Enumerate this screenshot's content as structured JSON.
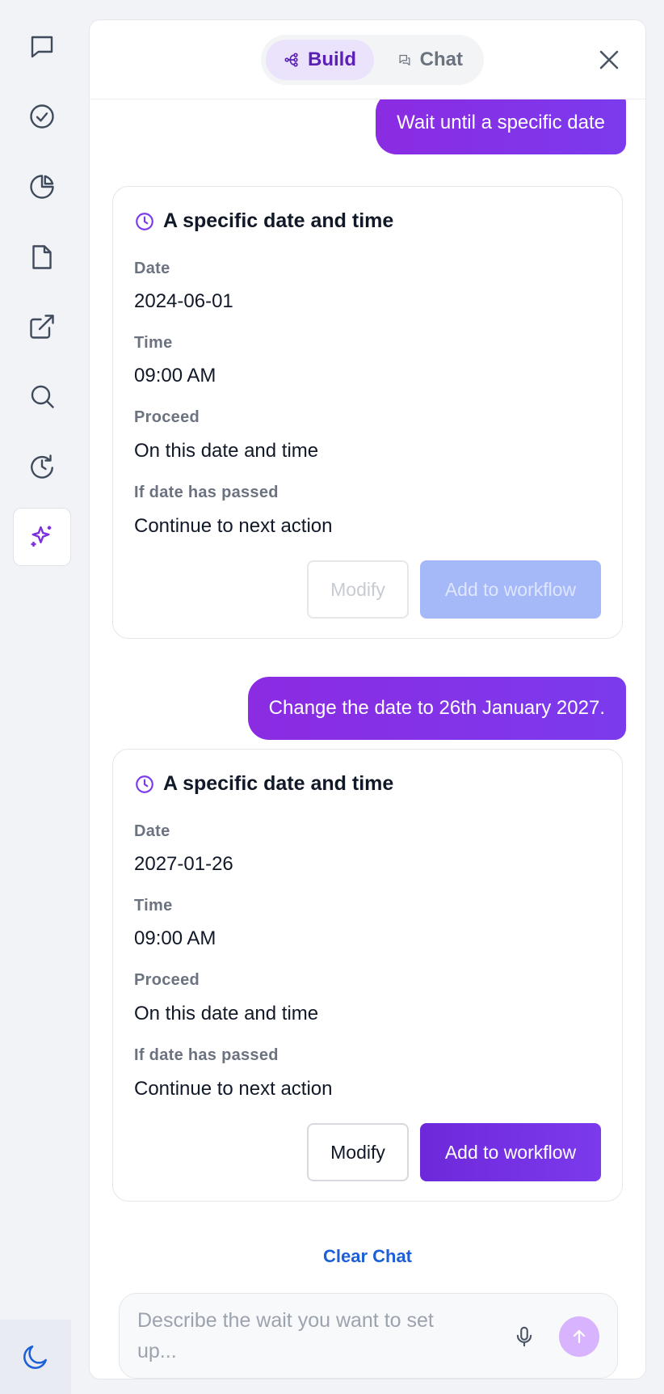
{
  "header": {
    "tabs": [
      {
        "label": "Build",
        "icon": "workflow-icon",
        "active": true
      },
      {
        "label": "Chat",
        "icon": "chat-bubbles-icon",
        "active": false
      }
    ],
    "close_icon": "close-icon"
  },
  "rail": {
    "items": [
      {
        "icon": "message-icon"
      },
      {
        "icon": "check-circle-icon"
      },
      {
        "icon": "pie-chart-icon"
      },
      {
        "icon": "document-icon"
      },
      {
        "icon": "external-link-icon"
      },
      {
        "icon": "search-icon"
      },
      {
        "icon": "history-icon"
      },
      {
        "icon": "sparkles-icon",
        "active": true
      }
    ],
    "bottom_icon": "moon-icon"
  },
  "messages": {
    "first_user": "Wait until a specific date",
    "second_user": "Change the date to 26th January 2027.",
    "card1": {
      "title": "A specific date and time",
      "date_label": "Date",
      "date_value": "2024-06-01",
      "time_label": "Time",
      "time_value": "09:00 AM",
      "proceed_label": "Proceed",
      "proceed_value": "On this date and time",
      "passed_label": "If date has passed",
      "passed_value": "Continue to next action",
      "modify_label": "Modify",
      "add_label": "Add to workflow",
      "disabled": true
    },
    "card2": {
      "title": "A specific date and time",
      "date_label": "Date",
      "date_value": "2027-01-26",
      "time_label": "Time",
      "time_value": "09:00 AM",
      "proceed_label": "Proceed",
      "proceed_value": "On this date and time",
      "passed_label": "If date has passed",
      "passed_value": "Continue to next action",
      "modify_label": "Modify",
      "add_label": "Add to workflow",
      "disabled": false
    }
  },
  "footer": {
    "clear_chat": "Clear Chat",
    "composer_placeholder": "Describe the wait you want to set up..."
  },
  "colors": {
    "accent": "#7c3aed",
    "link": "#1d5fd6",
    "disabled_button": "#a5b8f8"
  }
}
